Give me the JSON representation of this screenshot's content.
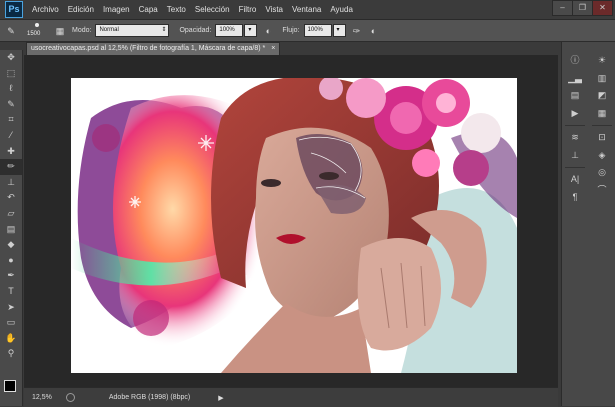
{
  "app": {
    "logo": "Ps"
  },
  "menu": [
    "Archivo",
    "Edición",
    "Imagen",
    "Capa",
    "Texto",
    "Selección",
    "Filtro",
    "Vista",
    "Ventana",
    "Ayuda"
  ],
  "window_controls": {
    "minimize": "–",
    "restore": "❐",
    "close": "✕"
  },
  "options": {
    "brush_size": "1500",
    "mode_label": "Modo:",
    "mode_value": "Normal",
    "opacity_label": "Opacidad:",
    "opacity_value": "100%",
    "flow_label": "Flujo:",
    "flow_value": "100%"
  },
  "document": {
    "tab_title": "usocreativocapas.psd al 12,5% (Filtro de fotografía 1, Máscara de capa/8) *",
    "close": "×"
  },
  "status": {
    "zoom": "12,5%",
    "profile": "Adobe RGB (1998) (8bpc)",
    "arrow": "▶"
  },
  "tools": [
    "move-icon",
    "marquee-icon",
    "lasso-icon",
    "quick-select-icon",
    "crop-icon",
    "eyedropper-icon",
    "healing-icon",
    "brush-icon",
    "clone-stamp-icon",
    "history-brush-icon",
    "eraser-icon",
    "gradient-icon",
    "blur-icon",
    "dodge-icon",
    "pen-icon",
    "type-icon",
    "path-select-icon",
    "shape-icon",
    "hand-icon",
    "zoom-icon"
  ],
  "dock_left": [
    "info-icon",
    "histogram-icon",
    "layers-comps-icon",
    "actions-icon",
    "brush-presets-icon",
    "clone-source-icon",
    "character-icon",
    "paragraph-icon"
  ],
  "dock_right": [
    "adjustments-icon",
    "styles-icon",
    "color-icon",
    "swatches-icon",
    "navigator-icon",
    "layers-icon",
    "channels-icon",
    "paths-icon"
  ],
  "colors": {
    "accent": "#4aa3df",
    "panel": "#535353",
    "canvas_bg": "#282828"
  }
}
